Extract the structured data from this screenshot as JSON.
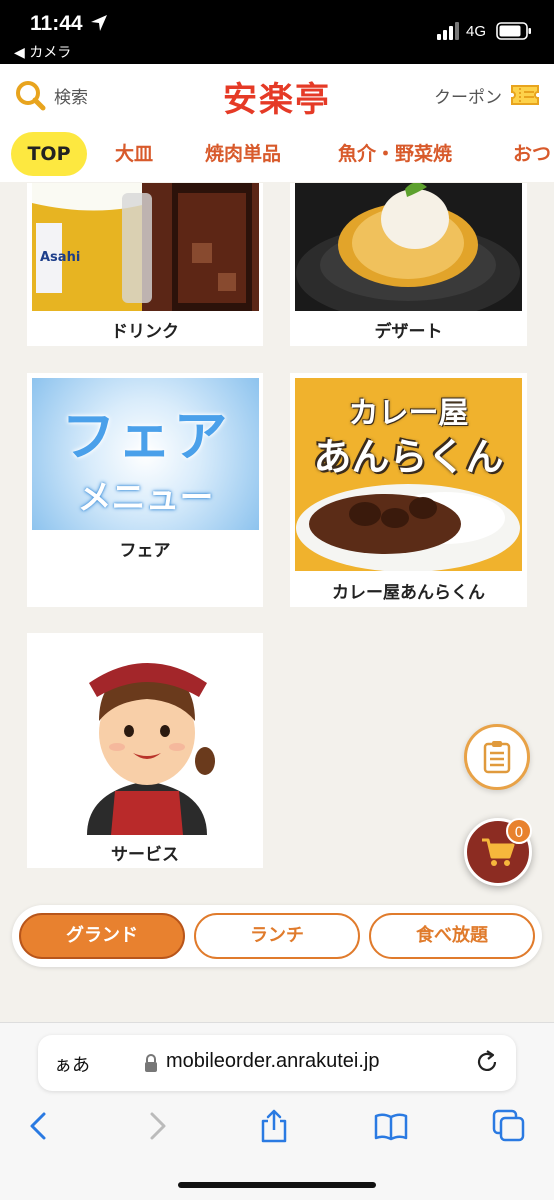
{
  "status_bar": {
    "time": "11:44",
    "back_app": "◀ カメラ",
    "network": "4G"
  },
  "header": {
    "search_label": "検索",
    "logo": "安楽亭",
    "coupon_label": "クーポン"
  },
  "tabs": [
    "TOP",
    "大皿",
    "焼肉単品",
    "魚介・野菜焼",
    "おつ"
  ],
  "active_tab": "TOP",
  "cards": [
    {
      "caption": "ドリンク"
    },
    {
      "caption": "デザート"
    },
    {
      "caption": "フェア",
      "image_text_1": "フェア",
      "image_text_2": "メニュー"
    },
    {
      "caption": "カレー屋あんらくん",
      "image_text_1": "カレー屋",
      "image_text_2": "あんらくん"
    },
    {
      "caption": "サービス"
    }
  ],
  "cart": {
    "count": "0"
  },
  "menu_types": [
    "グランド",
    "ランチ",
    "食べ放題"
  ],
  "active_menu_type": "グランド",
  "browser": {
    "aa": "ぁあ",
    "url": "mobileorder.anrakutei.jp"
  },
  "colors": {
    "accent": "#e8812f",
    "brand_red": "#e53a26",
    "tab_text": "#d85a2b",
    "active_tab_bg": "#fde840",
    "cart_bg": "#8c2c22"
  }
}
